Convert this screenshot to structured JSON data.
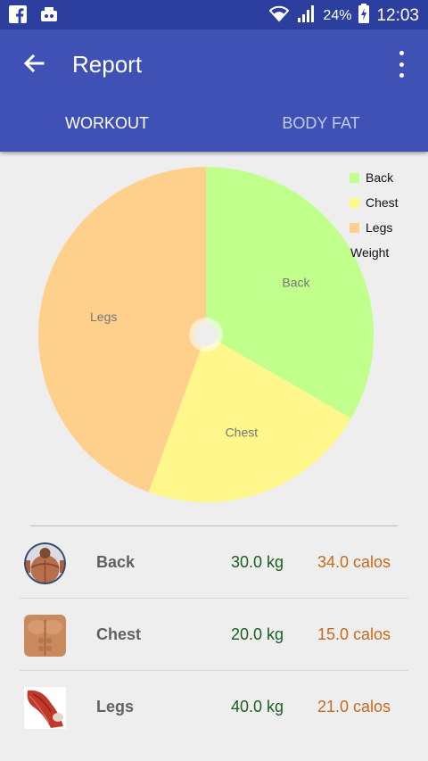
{
  "status_bar": {
    "battery_percent": "24%",
    "time": "12:03",
    "icons": [
      "facebook-icon",
      "notification-icon",
      "wifi-icon",
      "signal-icon",
      "battery-charging-icon"
    ]
  },
  "app_bar": {
    "title": "Report",
    "back_icon": "arrow-back-icon",
    "menu_icon": "more-vert-icon"
  },
  "tabs": [
    {
      "label": "WORKOUT",
      "active": true
    },
    {
      "label": "BODY FAT",
      "active": false
    }
  ],
  "colors": {
    "primary": "#3f51b5",
    "status_bar": "#2c3e9e",
    "weight_text": "#1b5e20",
    "calories_text": "#c56a1a"
  },
  "chart_data": {
    "type": "pie",
    "categories": [
      "Back",
      "Chest",
      "Legs"
    ],
    "values": [
      30.0,
      20.0,
      40.0
    ],
    "colors": [
      "#c0ff8c",
      "#fff68c",
      "#ffd08c"
    ],
    "legend": [
      "Back",
      "Chest",
      "Legs"
    ],
    "legend_description": "Weight",
    "legend_position": "top-right"
  },
  "report_rows": [
    {
      "name": "Back",
      "weight": "30.0 kg",
      "calories": "34.0 calos"
    },
    {
      "name": "Chest",
      "weight": "20.0 kg",
      "calories": "15.0 calos"
    },
    {
      "name": "Legs",
      "weight": "40.0 kg",
      "calories": "21.0 calos"
    }
  ]
}
